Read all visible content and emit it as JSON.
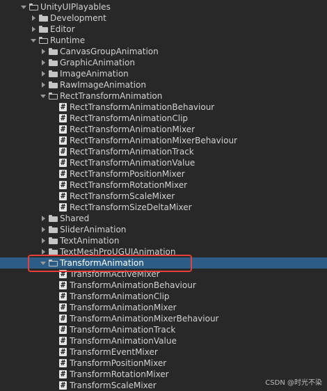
{
  "tree": {
    "root": "UnityUIPlayables",
    "top_folders": [
      "Development",
      "Editor"
    ],
    "runtime": "Runtime",
    "runtime_folders_a": [
      "CanvasGroupAnimation",
      "GraphicAnimation",
      "ImageAnimation",
      "RawImageAnimation"
    ],
    "rect_folder": "RectTransformAnimation",
    "rect_scripts": [
      "RectTransformAnimationBehaviour",
      "RectTransformAnimationClip",
      "RectTransformAnimationMixer",
      "RectTransformAnimationMixerBehaviour",
      "RectTransformAnimationTrack",
      "RectTransformAnimationValue",
      "RectTransformPositionMixer",
      "RectTransformRotationMixer",
      "RectTransformScaleMixer",
      "RectTransformSizeDeltaMixer"
    ],
    "runtime_folders_b": [
      "Shared",
      "SliderAnimation",
      "TextAnimation",
      "TextMeshProUGUIAnimation"
    ],
    "transform_folder": "TransformAnimation",
    "transform_scripts": [
      "TransformActiveMixer",
      "TransformAnimationBehaviour",
      "TransformAnimationClip",
      "TransformAnimationMixer",
      "TransformAnimationMixerBehaviour",
      "TransformAnimationTrack",
      "TransformAnimationValue",
      "TransformEventMixer",
      "TransformPositionMixer",
      "TransformRotationMixer",
      "TransformScaleMixer"
    ]
  },
  "colors": {
    "background": "#282828",
    "selection": "#2c5d87",
    "highlight_border": "#e5403b",
    "text": "#d2d2d2"
  },
  "watermark": "CSDN @时光不染"
}
